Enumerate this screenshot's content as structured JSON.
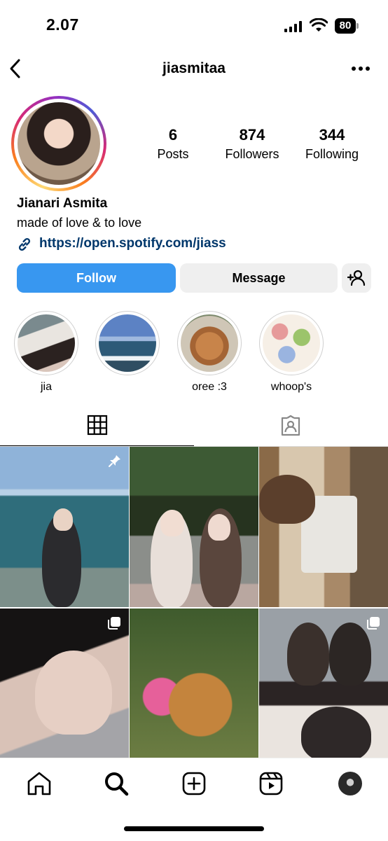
{
  "status_bar": {
    "time": "2.07",
    "battery": "80"
  },
  "header": {
    "username": "jiasmitaa",
    "back_icon": "chevron-left-icon",
    "more_icon": "more-horizontal-icon"
  },
  "profile": {
    "stats": [
      {
        "value": "6",
        "label": "Posts"
      },
      {
        "value": "874",
        "label": "Followers"
      },
      {
        "value": "344",
        "label": "Following"
      }
    ],
    "full_name": "Jianari Asmita",
    "bio": "made of love & to love",
    "link": "https://open.spotify.com/jiass"
  },
  "actions": {
    "follow": "Follow",
    "message": "Message"
  },
  "highlights": [
    {
      "label": "jia"
    },
    {
      "label": ""
    },
    {
      "label": "oree :3"
    },
    {
      "label": "whoop's"
    }
  ],
  "tabs": [
    {
      "icon": "grid-icon",
      "active": true
    },
    {
      "icon": "tagged-icon",
      "active": false
    }
  ],
  "posts": [
    {
      "badge": "pinned-icon"
    },
    {
      "badge": ""
    },
    {
      "badge": ""
    },
    {
      "badge": "carousel-icon"
    },
    {
      "badge": ""
    },
    {
      "badge": "carousel-icon"
    }
  ],
  "bottom_nav": [
    "home-icon",
    "search-icon",
    "create-icon",
    "reels-icon",
    "profile-avatar"
  ],
  "colors": {
    "accent": "#3897f0",
    "link": "#00376b",
    "secondary_button": "#efefef"
  }
}
